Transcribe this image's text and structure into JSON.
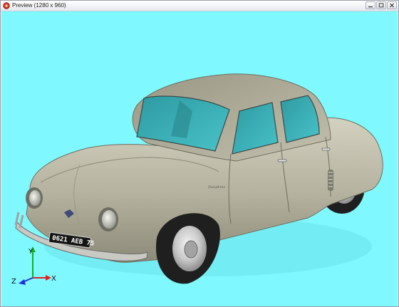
{
  "window": {
    "title": "Preview (1280 x 960)"
  },
  "viewport": {
    "background": "#7ff9ff",
    "subject": "car-model"
  },
  "car": {
    "body_color": "#b6b4a0",
    "glass_color": "#3fb4bc",
    "plate_text": "0621 AEB 75",
    "badge_text": "Dauphine"
  },
  "axes": {
    "x_label": "X",
    "y_label": "Y",
    "z_label": "Z",
    "x_color": "#e02020",
    "y_color": "#10b020",
    "z_color": "#2030e0"
  },
  "icons": {
    "app": "app-icon",
    "minimize": "minimize-icon",
    "maximize": "maximize-icon",
    "close": "close-icon"
  }
}
